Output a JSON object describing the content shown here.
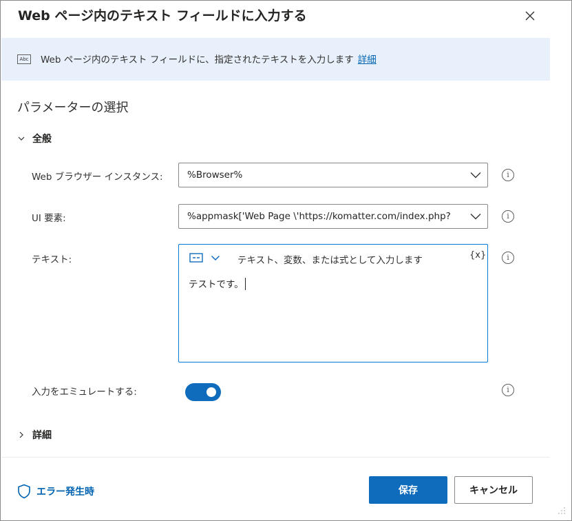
{
  "dialog": {
    "title": "Web ページ内のテキスト フィールドに入力する",
    "close_icon": "close-icon"
  },
  "info": {
    "icon": "abc-text-icon",
    "icon_text": "Abc",
    "text": "Web ページ内のテキスト フィールドに、指定されたテキストを入力します",
    "link": "詳細"
  },
  "section_title": "パラメーターの選択",
  "general": {
    "label": "全般",
    "browser": {
      "label": "Web ブラウザー インスタンス:",
      "value": "%Browser%"
    },
    "ui_element": {
      "label": "UI 要素:",
      "value": "%appmask['Web Page \\'https://komatter.com/index.php?"
    },
    "text": {
      "label": "テキスト:",
      "placeholder": "テキスト、変数、または式として入力します",
      "variable_button": "{x}",
      "value": "テストです。"
    },
    "emulate": {
      "label": "入力をエミュレートする:",
      "enabled": true
    },
    "info_icon_glyph": "i"
  },
  "advanced": {
    "label": "詳細"
  },
  "footer": {
    "error_label": "エラー発生時",
    "save_label": "保存",
    "cancel_label": "キャンセル"
  },
  "colors": {
    "accent": "#0f6cbd",
    "link": "#0063b1",
    "info_bg": "#e8f1fb"
  }
}
